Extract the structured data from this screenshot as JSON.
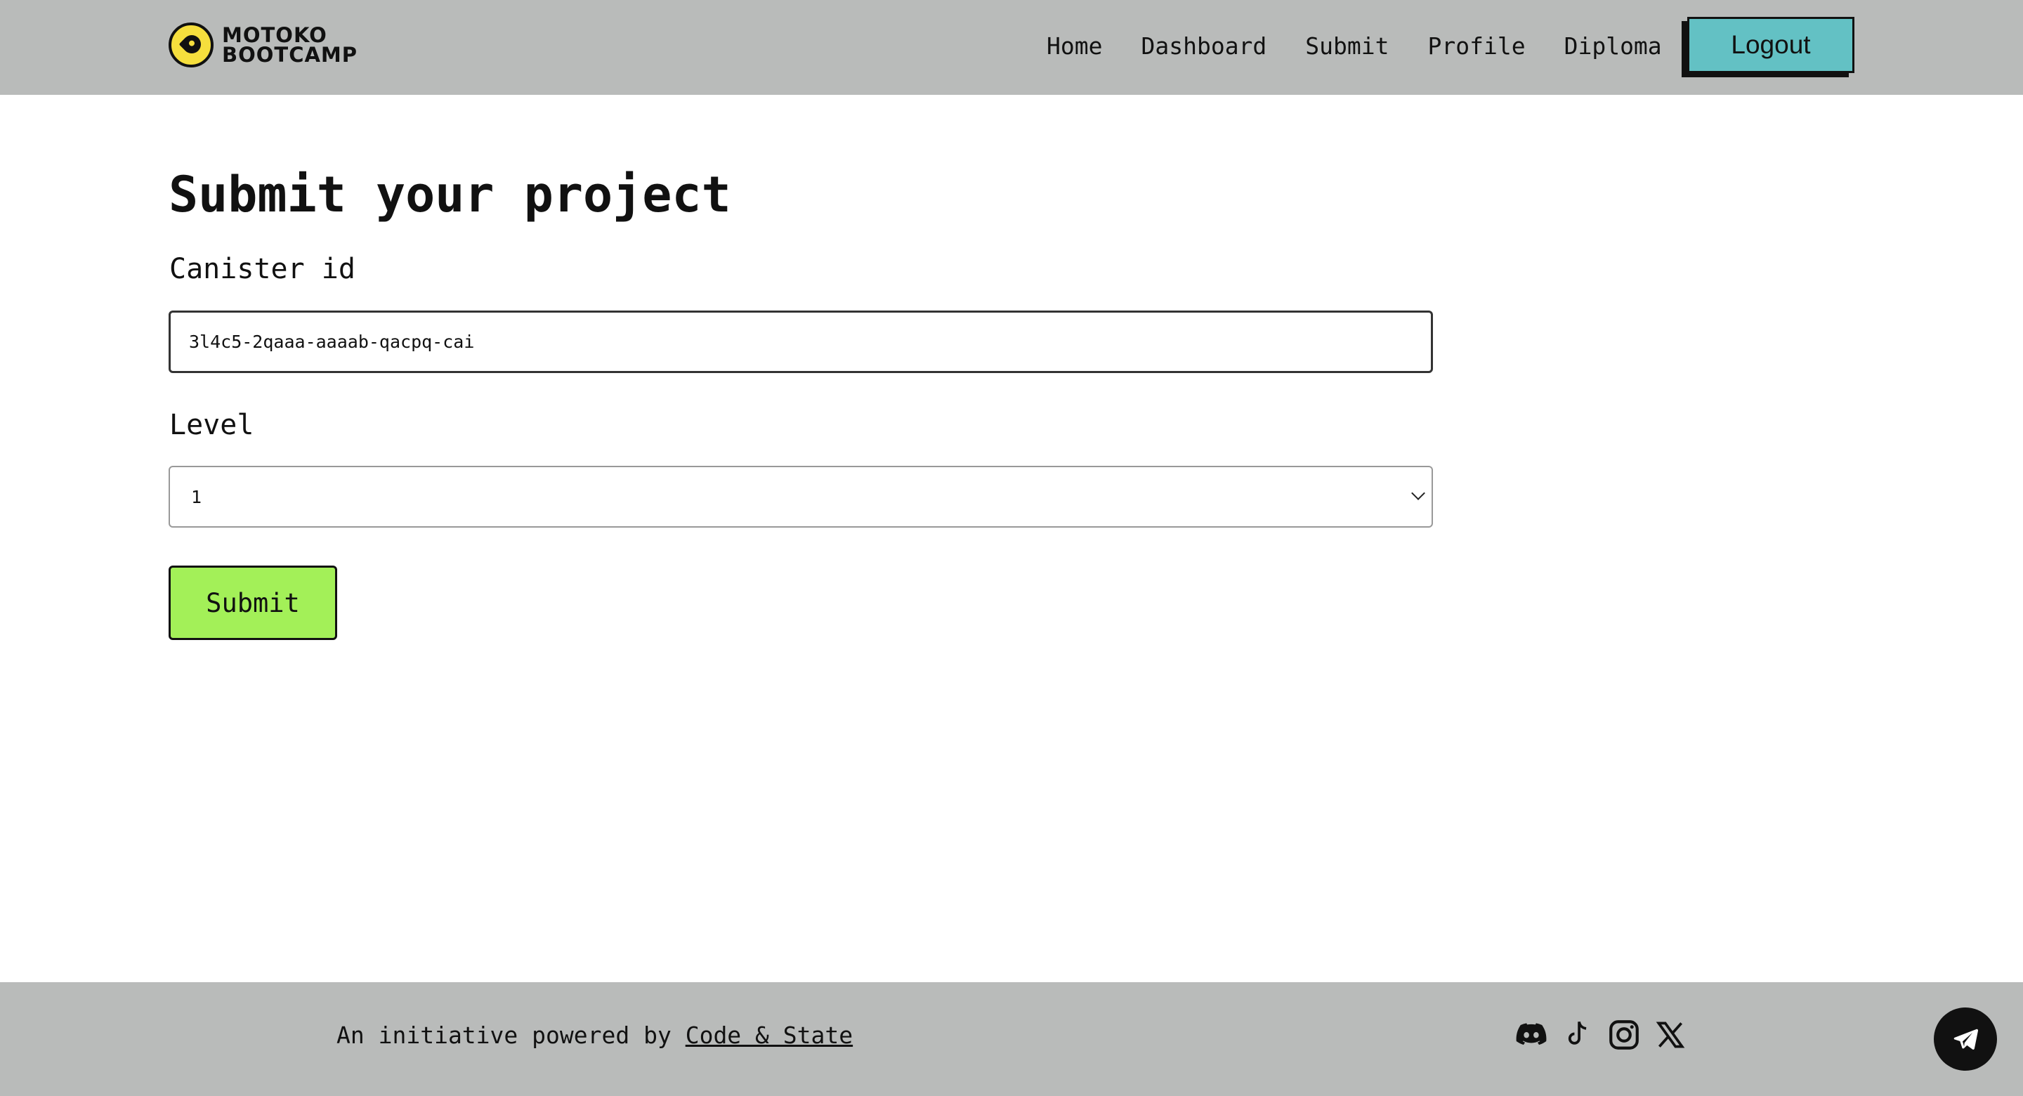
{
  "header": {
    "logo": {
      "line1": "MOTOKO",
      "line2": "BOOTCAMP"
    },
    "nav": [
      {
        "label": "Home"
      },
      {
        "label": "Dashboard"
      },
      {
        "label": "Submit"
      },
      {
        "label": "Profile"
      },
      {
        "label": "Diploma"
      }
    ],
    "logout_label": "Logout"
  },
  "main": {
    "title": "Submit your project",
    "canister": {
      "label": "Canister id",
      "value": "3l4c5-2qaaa-aaaab-qacpq-cai"
    },
    "level": {
      "label": "Level",
      "selected": "1"
    },
    "submit_label": "Submit"
  },
  "footer": {
    "text": "An initiative powered by",
    "link": "Code & State",
    "socials": [
      {
        "icon": "discord-icon"
      },
      {
        "icon": "tiktok-icon"
      },
      {
        "icon": "instagram-icon"
      },
      {
        "icon": "x-icon"
      }
    ],
    "fab_icon": "telegram-icon"
  },
  "colors": {
    "header_bg": "#b9bbba",
    "logout_bg": "#63c1c4",
    "submit_bg": "#a3f058",
    "logo_yellow": "#f6df3d"
  }
}
